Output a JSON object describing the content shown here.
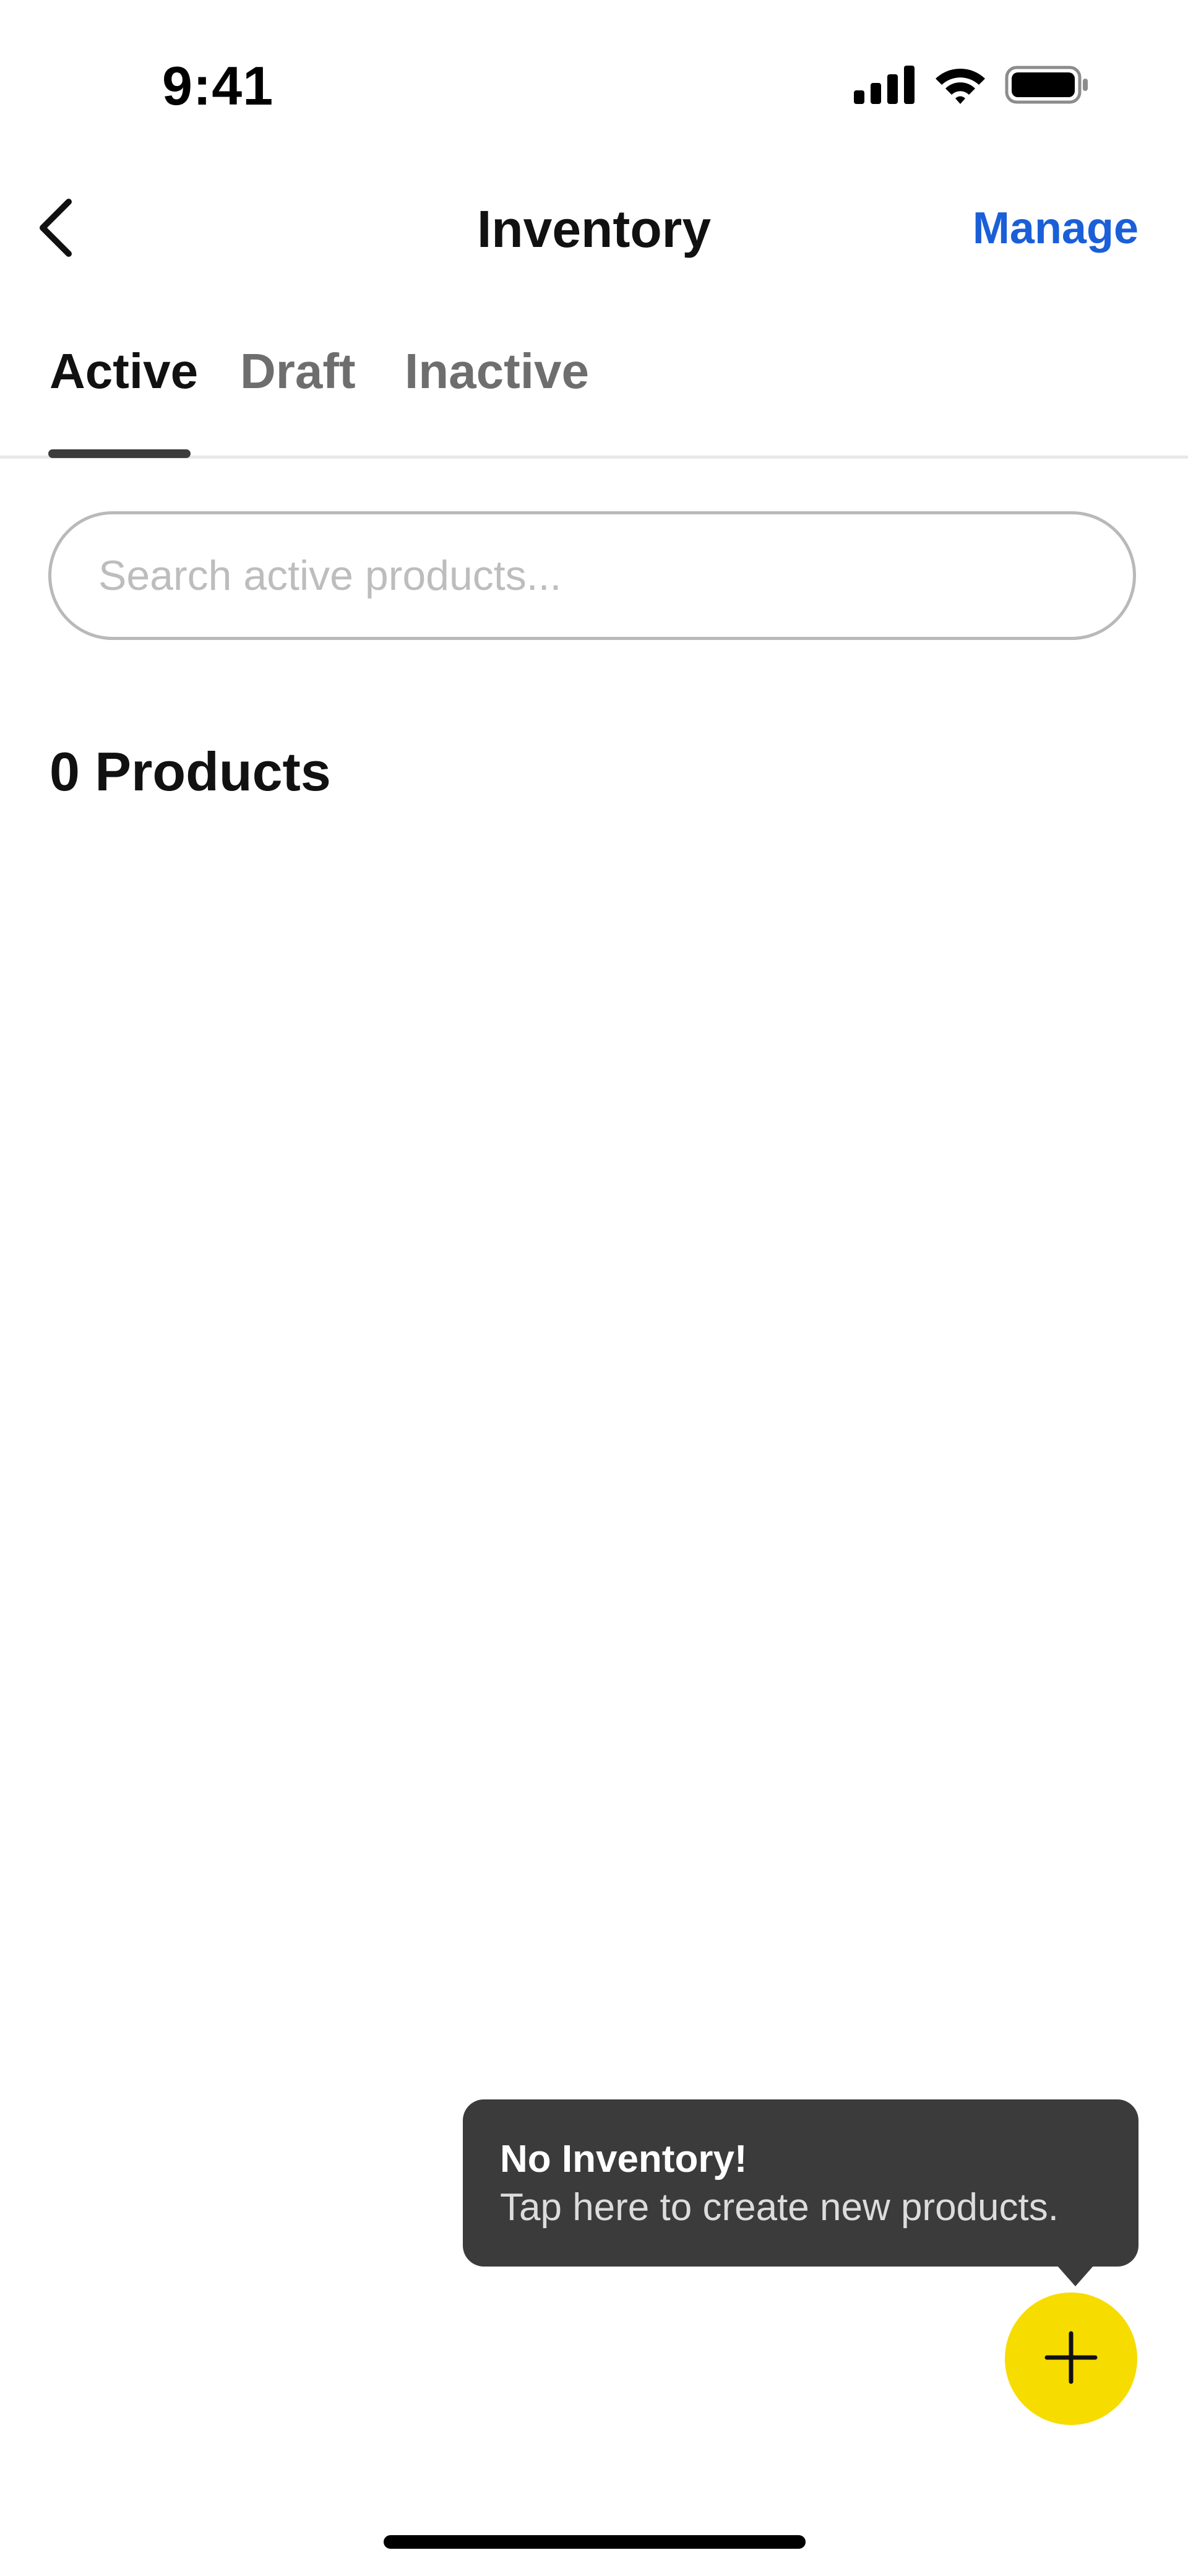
{
  "status_bar": {
    "time": "9:41",
    "icons": [
      "cellular-signal-icon",
      "wifi-icon",
      "battery-icon"
    ]
  },
  "nav": {
    "back_icon": "chevron-left-icon",
    "title": "Inventory",
    "manage_label": "Manage"
  },
  "tabs": [
    {
      "label": "Active",
      "selected": true
    },
    {
      "label": "Draft",
      "selected": false
    },
    {
      "label": "Inactive",
      "selected": false
    }
  ],
  "search": {
    "placeholder": "Search active products...",
    "value": ""
  },
  "products": {
    "count_label": "0 Products"
  },
  "tooltip": {
    "title": "No Inventory!",
    "body": "Tap here to create new products."
  },
  "fab": {
    "icon": "plus-icon"
  },
  "colors": {
    "accent_link": "#1a5fd8",
    "fab_background": "#f7dc00",
    "tooltip_background": "#3b3b3b",
    "tab_indicator": "#3c3c3c"
  }
}
